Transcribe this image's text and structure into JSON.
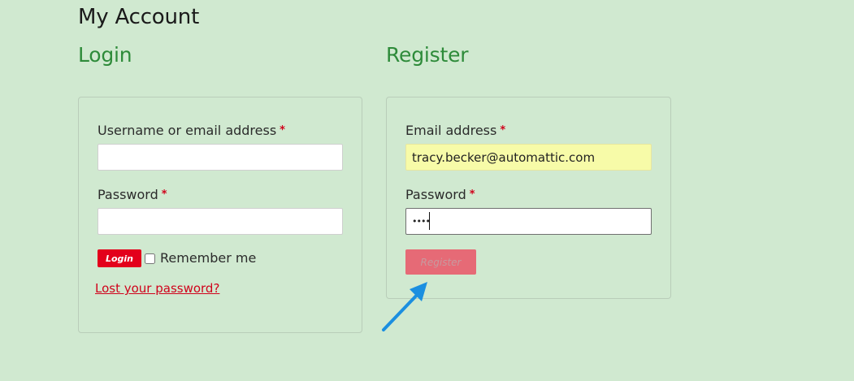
{
  "page": {
    "title": "My Account"
  },
  "login": {
    "heading": "Login",
    "username_label": "Username or email address",
    "password_label": "Password",
    "required_marker": "*",
    "username_value": "",
    "password_value": "",
    "login_button": "Login",
    "remember_label": "Remember me",
    "remember_checked": false,
    "lost_password_link": "Lost your password?"
  },
  "register": {
    "heading": "Register",
    "email_label": "Email address",
    "password_label": "Password",
    "required_marker": "*",
    "email_value": "tracy.becker@automattic.com",
    "password_value": "••••",
    "register_button": "Register"
  },
  "colors": {
    "background": "#d0e9d0",
    "heading_green": "#2e8b3a",
    "accent_red": "#e3001b",
    "register_disabled": "#e66a76",
    "autofill_yellow": "#f7fba8",
    "arrow_blue": "#1b8fe0"
  },
  "annotation": {
    "icon": "pointer-arrow-icon"
  }
}
